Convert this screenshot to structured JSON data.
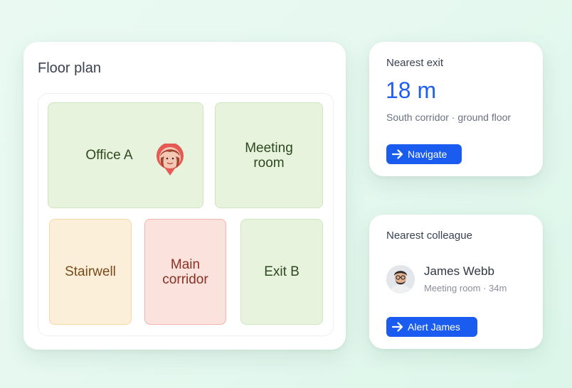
{
  "floor_plan": {
    "title": "Floor plan",
    "rooms": {
      "office_a": "Office A",
      "meeting_room": "Meeting room",
      "stairwell": "Stairwell",
      "main_corridor": "Main corridor",
      "exit_b": "Exit B"
    }
  },
  "nearest_exit": {
    "label": "Nearest exit",
    "distance": "18 m",
    "location": "South corridor · ground floor",
    "button_label": "Navigate"
  },
  "nearest_colleague": {
    "label": "Nearest colleague",
    "name": "James Webb",
    "detail": "Meeting room · 34m",
    "button_label": "Alert James"
  },
  "colors": {
    "accent": "#1a5cf0",
    "room_green": "#e8f3dd",
    "room_orange": "#fcefd9",
    "room_red": "#fbe2dd",
    "pin": "#e55a55"
  }
}
